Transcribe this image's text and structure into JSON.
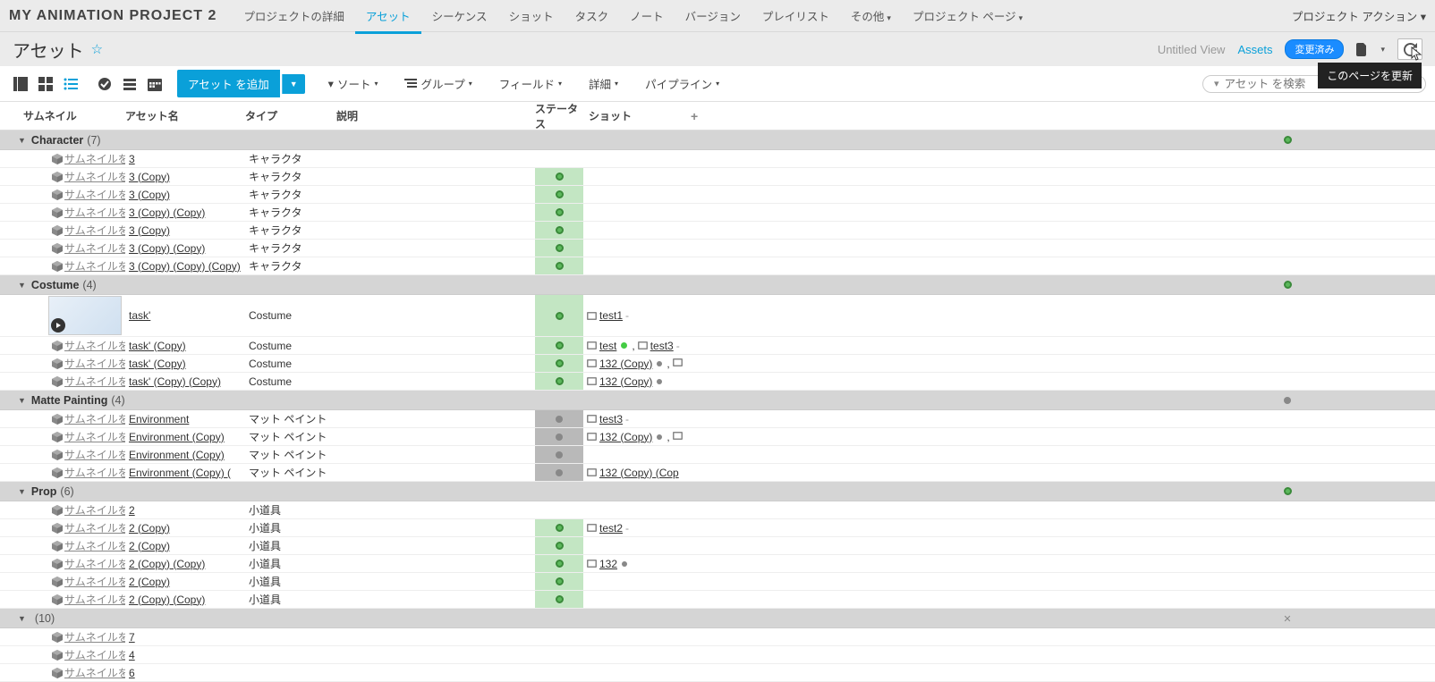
{
  "projectTitle": "MY ANIMATION PROJECT 2",
  "nav": {
    "items": [
      {
        "label": "プロジェクトの詳細"
      },
      {
        "label": "アセット",
        "active": true
      },
      {
        "label": "シーケンス"
      },
      {
        "label": "ショット"
      },
      {
        "label": "タスク"
      },
      {
        "label": "ノート"
      },
      {
        "label": "バージョン"
      },
      {
        "label": "プレイリスト"
      },
      {
        "label": "その他",
        "dropdown": true
      },
      {
        "label": "プロジェクト ページ",
        "dropdown": true
      }
    ],
    "projectActions": "プロジェクト アクション"
  },
  "subhead": {
    "pageTitle": "アセット",
    "untitledView": "Untitled View",
    "assetsLink": "Assets",
    "changedBadge": "変更済み",
    "tooltip": "このページを更新"
  },
  "toolbar": {
    "addButton": "アセット を追加",
    "sort": "ソート",
    "group": "グループ",
    "fields": "フィールド",
    "detail": "詳細",
    "pipeline": "パイプライン",
    "searchPlaceholder": "アセット を検索"
  },
  "columns": {
    "thumbnail": "サムネイル",
    "assetName": "アセット名",
    "type": "タイプ",
    "description": "説明",
    "status": "ステータス",
    "shot": "ショット"
  },
  "thumbPlaceholder": "サムネイルをア",
  "groups": [
    {
      "name": "Character",
      "count": 7,
      "statusDot": "green",
      "rows": [
        {
          "name": "3",
          "type": "キャラクタ",
          "status": "none"
        },
        {
          "name": "3 (Copy)",
          "type": "キャラクタ",
          "status": "green"
        },
        {
          "name": "3 (Copy)",
          "type": "キャラクタ",
          "status": "green"
        },
        {
          "name": "3 (Copy) (Copy)",
          "type": "キャラクタ",
          "status": "green"
        },
        {
          "name": "3 (Copy)",
          "type": "キャラクタ",
          "status": "green"
        },
        {
          "name": "3 (Copy) (Copy)",
          "type": "キャラクタ",
          "status": "green"
        },
        {
          "name": "3 (Copy) (Copy) (Copy)",
          "type": "キャラクタ",
          "status": "green"
        }
      ]
    },
    {
      "name": "Costume",
      "count": 4,
      "statusDot": "green",
      "rows": [
        {
          "name": "task'",
          "type": "Costume",
          "status": "green",
          "thumb": "img",
          "shots": [
            {
              "t": "test1",
              "dash": true
            }
          ]
        },
        {
          "name": "task' (Copy)",
          "type": "Costume",
          "status": "green",
          "shots": [
            {
              "t": "test",
              "gdot": true
            },
            {
              "comma": true
            },
            {
              "t": "test3",
              "dash": true
            }
          ]
        },
        {
          "name": "task' (Copy)",
          "type": "Costume",
          "status": "green",
          "shots": [
            {
              "t": "132 (Copy)",
              "grey": true
            },
            {
              "more": true
            }
          ]
        },
        {
          "name": "task' (Copy) (Copy)",
          "type": "Costume",
          "status": "green",
          "shots": [
            {
              "t": "132 (Copy)",
              "grey": true
            }
          ]
        }
      ]
    },
    {
      "name": "Matte Painting",
      "count": 4,
      "statusDot": "grey",
      "rows": [
        {
          "name": "Environment",
          "type": "マット ペイント",
          "status": "grey",
          "shots": [
            {
              "t": "test3",
              "dash": true
            }
          ]
        },
        {
          "name": "Environment (Copy)",
          "type": "マット ペイント",
          "status": "grey",
          "shots": [
            {
              "t": "132 (Copy)",
              "grey": true
            },
            {
              "more": true
            }
          ]
        },
        {
          "name": "Environment (Copy)",
          "type": "マット ペイント",
          "status": "grey"
        },
        {
          "name": "Environment (Copy) (",
          "type": "マット ペイント",
          "status": "grey",
          "shots": [
            {
              "t": "132 (Copy) (Cop"
            }
          ]
        }
      ]
    },
    {
      "name": "Prop",
      "count": 6,
      "statusDot": "green",
      "rows": [
        {
          "name": "2",
          "type": "小道具",
          "status": "none"
        },
        {
          "name": "2 (Copy)",
          "type": "小道具",
          "status": "green",
          "shots": [
            {
              "t": "test2",
              "dash": true
            }
          ]
        },
        {
          "name": "2 (Copy)",
          "type": "小道具",
          "status": "green"
        },
        {
          "name": "2 (Copy) (Copy)",
          "type": "小道具",
          "status": "green",
          "shots": [
            {
              "t": "132",
              "grey": true
            }
          ]
        },
        {
          "name": "2 (Copy)",
          "type": "小道具",
          "status": "green"
        },
        {
          "name": "2 (Copy) (Copy)",
          "type": "小道具",
          "status": "green"
        }
      ]
    },
    {
      "name": "",
      "count": 10,
      "statusDot": "x",
      "rows": [
        {
          "name": "7",
          "type": "",
          "status": "none"
        },
        {
          "name": "4",
          "type": "",
          "status": "none"
        },
        {
          "name": "6",
          "type": "",
          "status": "none"
        }
      ]
    }
  ]
}
